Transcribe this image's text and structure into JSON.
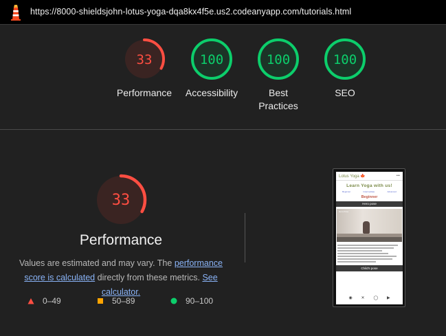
{
  "browser": {
    "url": "https://8000-shieldsjohn-lotus-yoga-dqa8kx4f5e.us2.codeanyapp.com/tutorials.html"
  },
  "gauges": [
    {
      "score": "33",
      "value": 33,
      "label": "Performance",
      "color": "#ff4e42",
      "bg": "#3a2422"
    },
    {
      "score": "100",
      "value": 100,
      "label": "Accessibility",
      "color": "#0cce6b",
      "bg": "#1c3327"
    },
    {
      "score": "100",
      "value": 100,
      "label": "Best Practices",
      "color": "#0cce6b",
      "bg": "#1c3327"
    },
    {
      "score": "100",
      "value": 100,
      "label": "SEO",
      "color": "#0cce6b",
      "bg": "#1c3327"
    }
  ],
  "performance": {
    "score": "33",
    "value": 33,
    "title": "Performance",
    "desc_prefix": "Values are estimated and may vary. The ",
    "link1": "performance score is calculated",
    "desc_middle": " directly from these metrics. ",
    "link2": "See calculator.",
    "color": "#ff4e42"
  },
  "legend": [
    {
      "range": "0–49",
      "shape": "triangle",
      "color": "#ff4e42"
    },
    {
      "range": "50–89",
      "shape": "square",
      "color": "#ffa400"
    },
    {
      "range": "90–100",
      "shape": "circle",
      "color": "#0cce6b"
    }
  ],
  "thumbnail": {
    "brand": "Lotus Yoga 🍁",
    "menu": "•••",
    "hero_title": "Learn Yoga with us!",
    "links": [
      "Beginner",
      "Intermediate",
      "Advanced"
    ],
    "level": "Beginner",
    "pose1": "Hero pose",
    "video_title": "Hero Pose",
    "pose2": "Child's pose",
    "footer_icons": [
      "facebook-icon",
      "x-icon",
      "instagram-icon",
      "youtube-icon"
    ]
  }
}
